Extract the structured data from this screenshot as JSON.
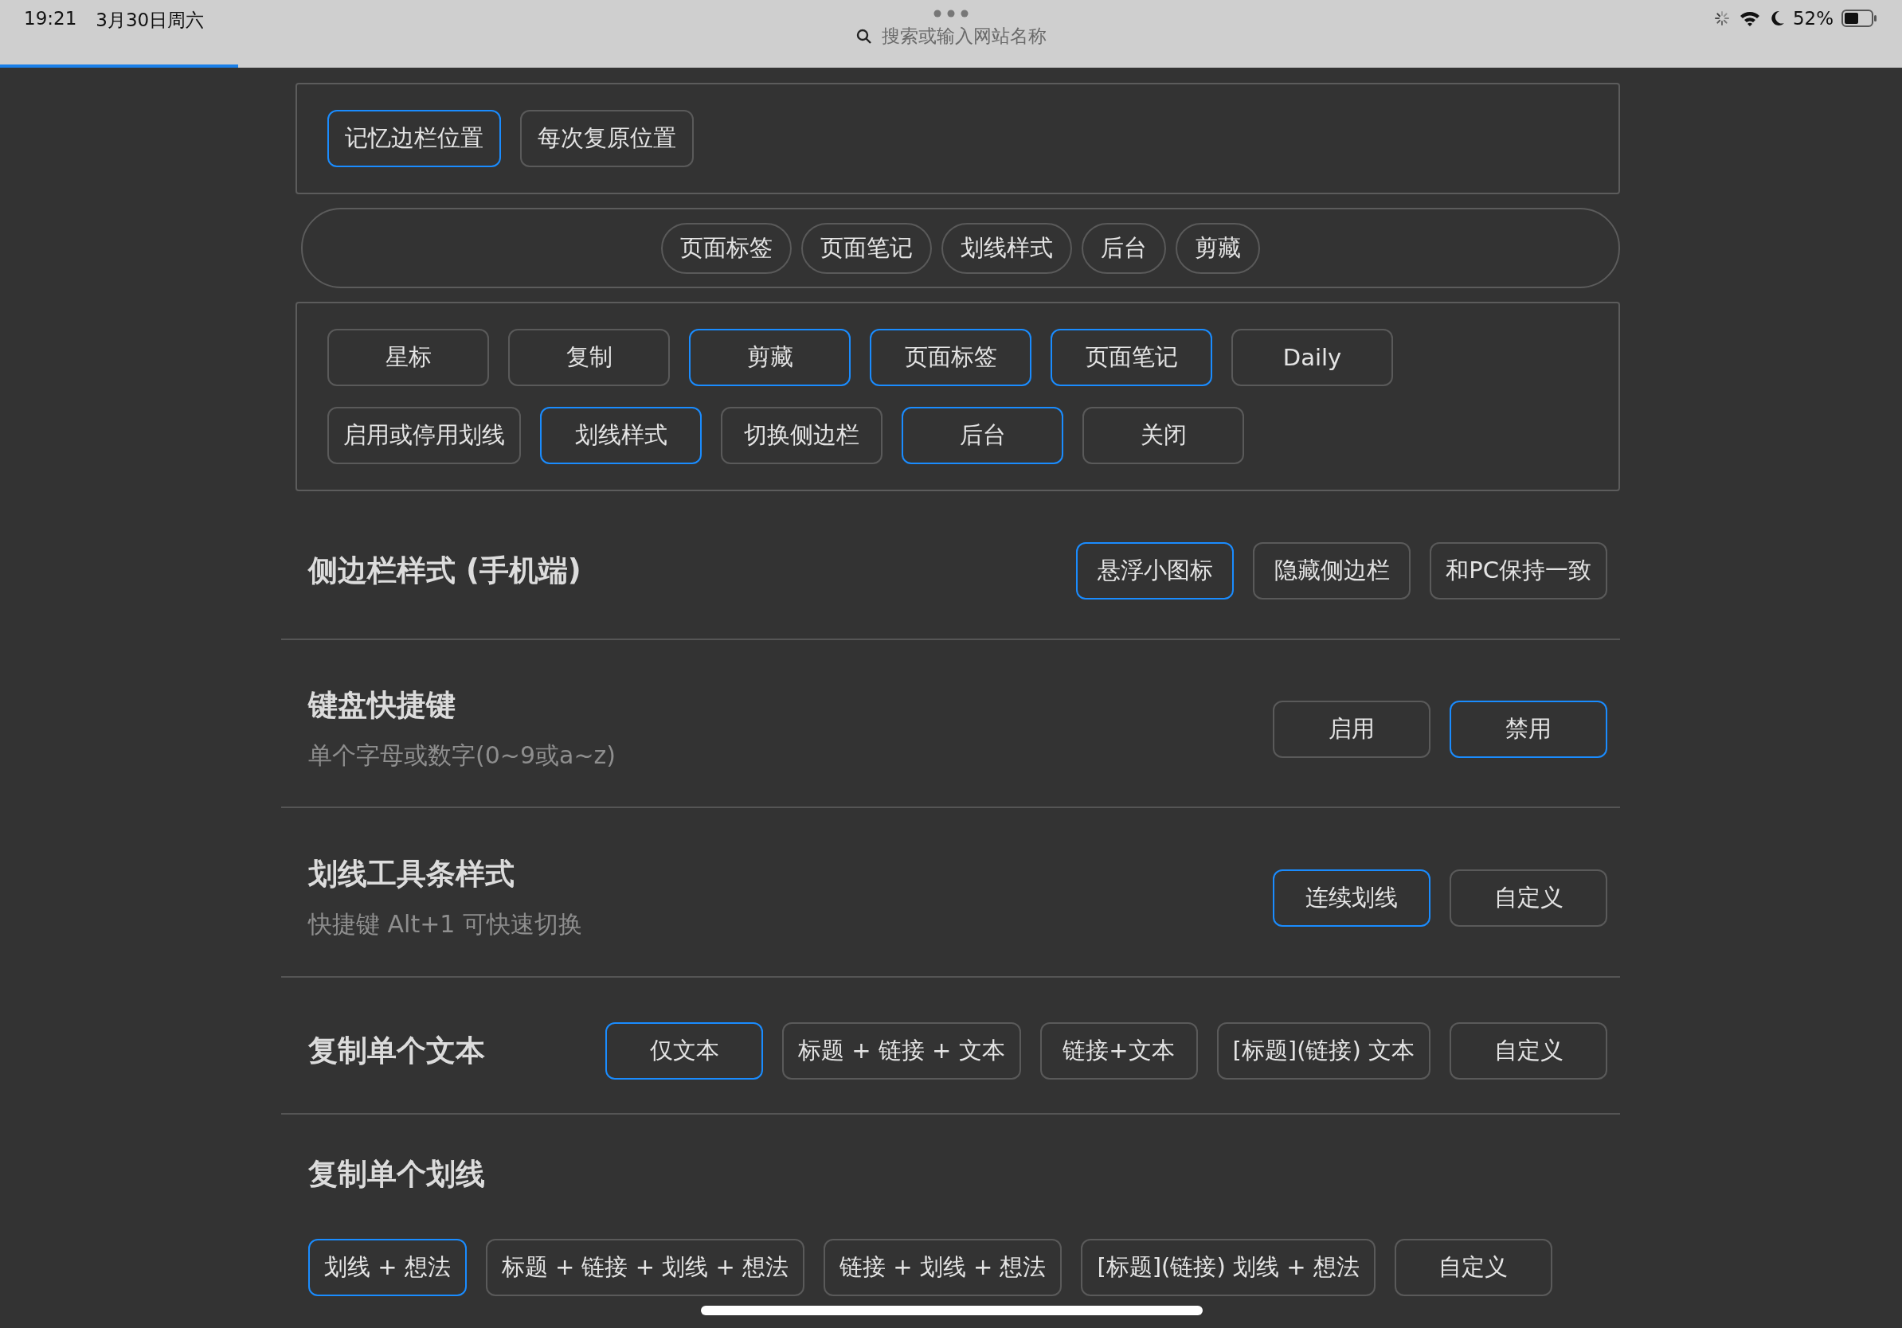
{
  "status_bar": {
    "time": "19:21",
    "date": "3月30日周六",
    "search_placeholder": "搜索或输入网站名称",
    "battery": "52%",
    "load_progress": {
      "level": 0.125
    }
  },
  "position_options": [
    {
      "label": "记忆边栏位置",
      "selected": true
    },
    {
      "label": "每次复原位置",
      "selected": false
    }
  ],
  "tab_chips": [
    {
      "label": "页面标签"
    },
    {
      "label": "页面笔记"
    },
    {
      "label": "划线样式"
    },
    {
      "label": "后台"
    },
    {
      "label": "剪藏"
    }
  ],
  "toolbar_buttons": [
    {
      "label": "星标",
      "selected": false
    },
    {
      "label": "复制",
      "selected": false
    },
    {
      "label": "剪藏",
      "selected": true
    },
    {
      "label": "页面标签",
      "selected": true
    },
    {
      "label": "页面笔记",
      "selected": true
    },
    {
      "label": "Daily",
      "selected": false
    },
    {
      "label": "启用或停用划线",
      "selected": false
    },
    {
      "label": "划线样式",
      "selected": true
    },
    {
      "label": "切换侧边栏",
      "selected": false
    },
    {
      "label": "后台",
      "selected": true
    },
    {
      "label": "关闭",
      "selected": false
    }
  ],
  "settings": [
    {
      "kind": "inline",
      "title": "侧边栏样式 (手机端)",
      "options": [
        {
          "label": "悬浮小图标",
          "selected": true
        },
        {
          "label": "隐藏侧边栏",
          "selected": false
        },
        {
          "label": "和PC保持一致",
          "selected": false
        }
      ]
    },
    {
      "kind": "inline",
      "title": "键盘快捷键",
      "subtitle": "单个字母或数字(0~9或a~z)",
      "options": [
        {
          "label": "启用",
          "selected": false
        },
        {
          "label": "禁用",
          "selected": true
        }
      ]
    },
    {
      "kind": "inline",
      "title": "划线工具条样式",
      "subtitle": "快捷键 Alt+1 可快速切换",
      "options": [
        {
          "label": "连续划线",
          "selected": true
        },
        {
          "label": "自定义",
          "selected": false
        }
      ]
    },
    {
      "kind": "inline",
      "title": "复制单个文本",
      "options": [
        {
          "label": "仅文本",
          "selected": true
        },
        {
          "label": "标题 + 链接 + 文本",
          "selected": false
        },
        {
          "label": "链接+文本",
          "selected": false
        },
        {
          "label": "[标题](链接) 文本",
          "selected": false
        },
        {
          "label": "自定义",
          "selected": false
        }
      ]
    },
    {
      "kind": "below",
      "title": "复制单个划线",
      "options": [
        {
          "label": "划线 + 想法",
          "selected": true
        },
        {
          "label": "标题 + 链接 + 划线 + 想法",
          "selected": false
        },
        {
          "label": "链接 + 划线 + 想法",
          "selected": false
        },
        {
          "label": "[标题](链接) 划线 + 想法",
          "selected": false
        },
        {
          "label": "自定义",
          "selected": false
        }
      ]
    }
  ]
}
